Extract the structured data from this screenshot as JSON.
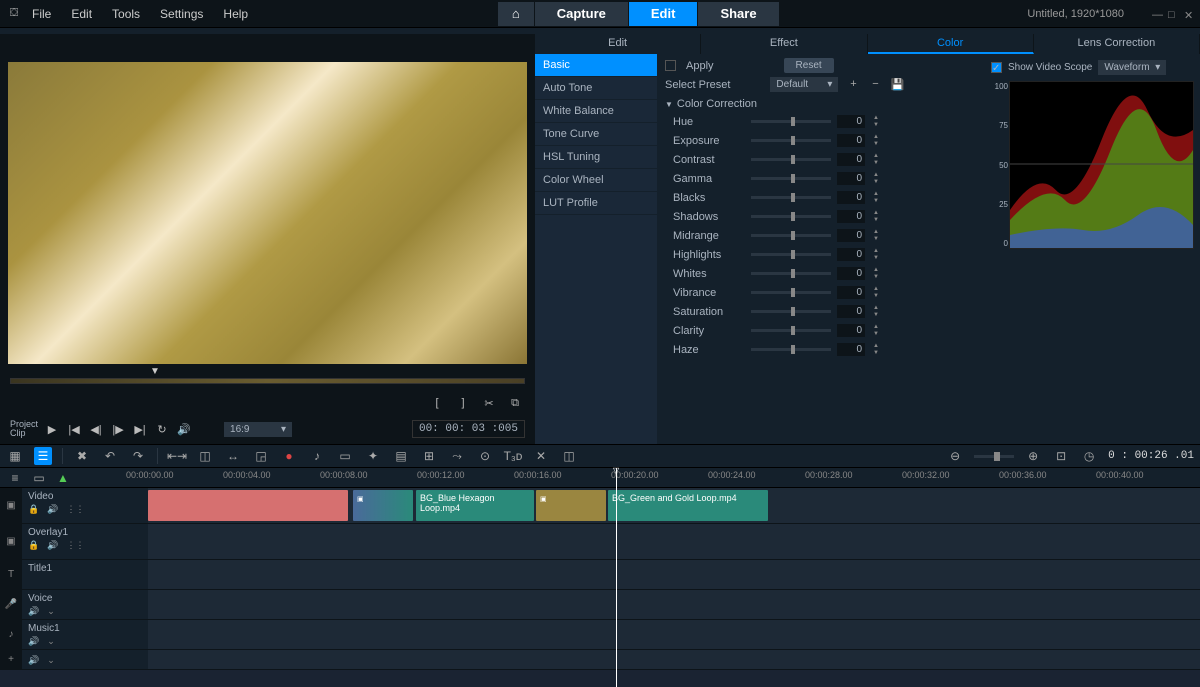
{
  "menu": [
    "File",
    "Edit",
    "Tools",
    "Settings",
    "Help"
  ],
  "main_tabs": {
    "home": "⌂",
    "capture": "Capture",
    "edit": "Edit",
    "share": "Share"
  },
  "project": {
    "title": "Untitled, 1920*1080"
  },
  "preview": {
    "mode_label1": "Project",
    "mode_label2": "Clip",
    "timecode": "00: 00: 03 :005",
    "ratio": "16:9"
  },
  "props": {
    "tabs": [
      "Edit",
      "Effect",
      "Color",
      "Lens Correction"
    ],
    "side": [
      "Basic",
      "Auto Tone",
      "White Balance",
      "Tone Curve",
      "HSL Tuning",
      "Color Wheel",
      "LUT Profile"
    ],
    "apply": "Apply",
    "reset": "Reset",
    "select_preset": "Select Preset",
    "preset_val": "Default",
    "section": "Color Correction",
    "params": [
      {
        "label": "Hue",
        "val": "0"
      },
      {
        "label": "Exposure",
        "val": "0"
      },
      {
        "label": "Contrast",
        "val": "0"
      },
      {
        "label": "Gamma",
        "val": "0"
      },
      {
        "label": "Blacks",
        "val": "0"
      },
      {
        "label": "Shadows",
        "val": "0"
      },
      {
        "label": "Midrange",
        "val": "0"
      },
      {
        "label": "Highlights",
        "val": "0"
      },
      {
        "label": "Whites",
        "val": "0"
      },
      {
        "label": "Vibrance",
        "val": "0"
      },
      {
        "label": "Saturation",
        "val": "0"
      },
      {
        "label": "Clarity",
        "val": "0"
      },
      {
        "label": "Haze",
        "val": "0"
      }
    ],
    "scope_label": "Show Video Scope",
    "scope_type": "Waveform",
    "scope_ticks": [
      "100",
      "75",
      "50",
      "25",
      "0"
    ]
  },
  "ruler": [
    "00:00:00.00",
    "00:00:04.00",
    "00:00:08.00",
    "00:00:12.00",
    "00:00:16.00",
    "00:00:20.00",
    "00:00:24.00",
    "00:00:28.00",
    "00:00:32.00",
    "00:00:36.00",
    "00:00:40.00"
  ],
  "tracks": [
    {
      "name": "Video"
    },
    {
      "name": "Overlay1"
    },
    {
      "name": "Title1"
    },
    {
      "name": "Voice"
    },
    {
      "name": "Music1"
    }
  ],
  "clips": {
    "blue_hex": "BG_Blue Hexagon Loop.mp4",
    "green_gold": "BG_Green and Gold Loop.mp4"
  },
  "timeline_tc": "0 : 00:26 .01"
}
